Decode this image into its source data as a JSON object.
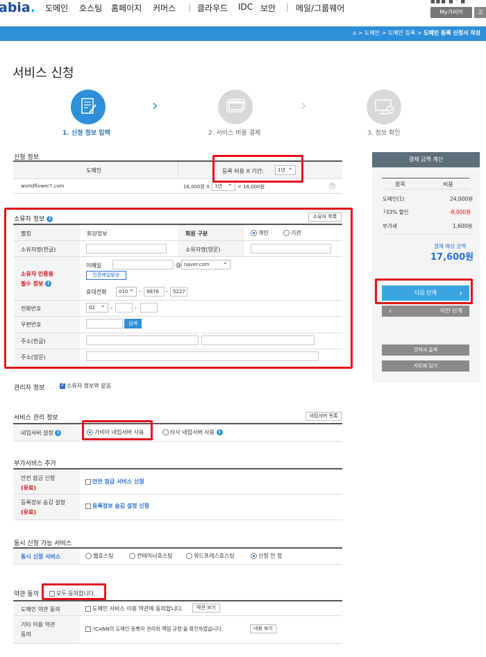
{
  "nav": {
    "logo_main": "abia",
    "logo_dot": ".",
    "items": [
      "도메인",
      "호스팅",
      "홈페이지",
      "커머스",
      "클라우드",
      "IDC",
      "보안",
      "메일/그룹웨어"
    ],
    "separators": [
      "|",
      "|"
    ],
    "mygabia": "My가비아",
    "extra_btn": "고",
    "top_dots": "■■■ ■ · ■"
  },
  "breadcrumb": {
    "home_icon": "home-icon",
    "items": [
      "도메인",
      "도메인 등록"
    ],
    "current": "도메인 등록 신청서 작성",
    "sep": ">"
  },
  "page_title": "서비스 신청",
  "steps": [
    {
      "label": "1. 신청 정보 입력",
      "icon": "form-document-icon",
      "active": true
    },
    {
      "label": "2. 서비스 비용 결제",
      "icon": "credit-card-icon",
      "active": false
    },
    {
      "label": "3. 정보 확인",
      "icon": "monitor-check-icon",
      "active": false
    }
  ],
  "apply_info": {
    "title": "신청 정보",
    "col_domain": "도메인",
    "col_cost": "등록 비용 X 기간:",
    "period_select": "1년",
    "domain": "worldflower7.com",
    "price": "16,000원 X",
    "row_period": "1년",
    "total": "= 16,000원",
    "remove_icon": "close-icon"
  },
  "owner": {
    "title": "소유자 정보",
    "list_btn": "소유자 목록",
    "label_alias": "별칭",
    "alias_value": "회원정보",
    "label_member_type": "회원 구분",
    "radio_personal": "개인",
    "radio_org": "기관",
    "label_name_ko": "소유자명(한글)",
    "label_name_en": "소유자명(영문)",
    "label_verify_1": "소유자 인증용",
    "label_verify_2": "필수 정보",
    "label_email": "이메일",
    "at": "@",
    "email_domain": "naver.com",
    "send_verify_btn": "인증메일발송",
    "label_mobile": "휴대전화",
    "mobile": [
      "010",
      "9876",
      "5227"
    ],
    "dash": "-",
    "label_phone": "전화번호",
    "phone_area": "02",
    "label_zip": "우편번호",
    "search_btn": "검색",
    "label_addr_ko": "주소(한글)",
    "label_addr_en": "주소(영문)"
  },
  "manager": {
    "title": "관리자 정보",
    "same_as_owner": "소유자 정보와 같음"
  },
  "service_mgmt": {
    "title": "서비스 관리 정보",
    "ns_list_btn": "네임서버 목록",
    "label_ns": "네임서버 설정",
    "opt_gabia": "가비아 네임서버 사용",
    "opt_other": "타사 네임서버 사용"
  },
  "addon": {
    "title": "부가서비스 추가",
    "lock_label": "안전 잠금 신청",
    "paid": "(유료)",
    "lock_option": "안전 잠금 서비스 신청",
    "privacy_label": "등록정보 숨김 설정",
    "privacy_option": "등록정보 숨김 설정 신청"
  },
  "concurrent": {
    "title": "동시 신청 가능 서비스",
    "label": "동시 신청 서비스",
    "options": [
      "웹호스팅",
      "컨테이너호스팅",
      "워드프레스호스팅",
      "신청 안 함"
    ]
  },
  "terms": {
    "title": "약관 동의",
    "agree_all": "모두 동의합니다.",
    "label_domain_terms": "도메인 약관 동의",
    "domain_terms_text": "도메인 서비스 이용 약관에 동의합니다.",
    "view_terms_btn": "약관 보기",
    "label_other_1": "기타 이용 약관",
    "label_other_2": "동의",
    "other_text": "'ICANN의 도메인 등록자 권리와 책임 규정'을 확인하였습니다.",
    "view_content_btn": "내용 보기"
  },
  "summary": {
    "title": "결제 금액 계산",
    "col_item": "항목",
    "col_cost": "비용",
    "rows": [
      {
        "item": "도메인(1)",
        "cost": "24,000원"
      },
      {
        "item": "└33% 할인",
        "cost": "-8,000원"
      },
      {
        "item": "부가세",
        "cost": "1,600원"
      }
    ],
    "total_label": "결제 예상 금액",
    "total": "17,600원",
    "next_btn": "다음 단계",
    "next_arrow": "›",
    "prev_btn": "이전 단계",
    "prev_arrow": "‹",
    "quote_btn": "견적서 출력",
    "cart_btn": "카트에 담기"
  },
  "colors": {
    "brand_blue": "#2f8fd8",
    "highlight_red": "#e3111b",
    "panel_head": "#5d6e7b",
    "next_btn": "#3aa5e0",
    "gray_btn": "#8a8a8a"
  }
}
